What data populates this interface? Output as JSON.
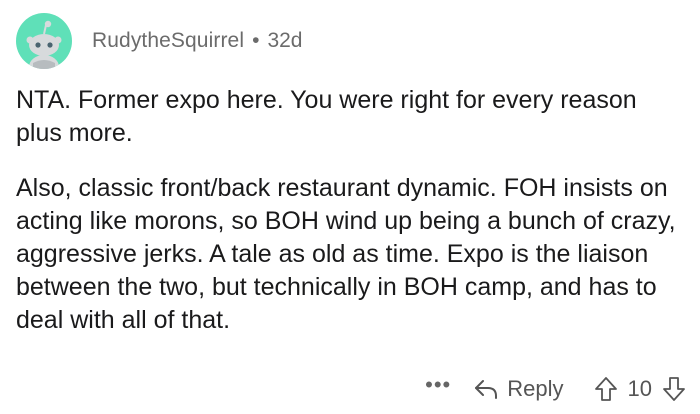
{
  "comment": {
    "author": "RudytheSquirrel",
    "separator": "•",
    "age": "32d",
    "paragraphs": [
      "NTA.  Former expo here.  You were right for every reason plus more.",
      "Also, classic front/back restaurant dynamic.  FOH insists on acting like morons, so BOH wind up being a bunch of crazy, aggressive jerks.  A tale as old as time.  Expo is the liaison between the two, but technically in BOH camp, and has to deal with all of that."
    ]
  },
  "actions": {
    "more_label": "•••",
    "reply_label": "Reply",
    "vote_count": "10"
  },
  "icons": {
    "avatar": "snoo-avatar-icon",
    "reply": "reply-arrow-icon",
    "upvote": "upvote-arrow-icon",
    "downvote": "downvote-arrow-icon"
  },
  "colors": {
    "avatar_bg": "#5fe0b8",
    "meta_text": "#6b6b6b",
    "body_text": "#1a1a1b"
  }
}
